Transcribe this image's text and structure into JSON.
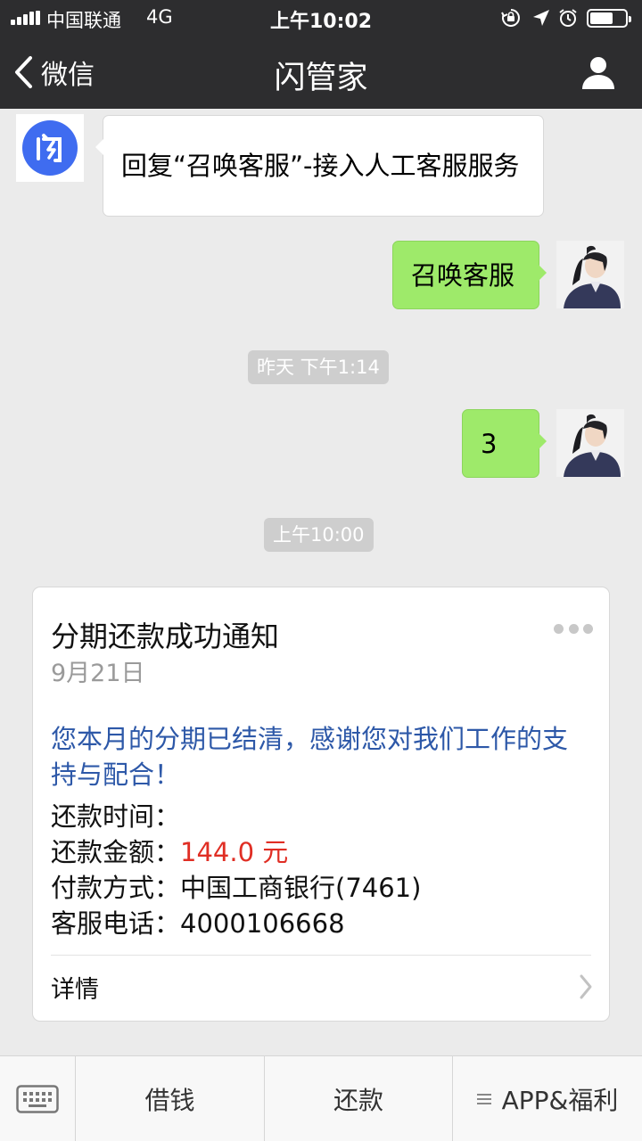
{
  "status_bar": {
    "carrier": "中国联通",
    "network": "4G",
    "time": "上午10:02",
    "battery_level": 0.65
  },
  "nav": {
    "back_label": "微信",
    "title": "闪管家"
  },
  "messages": [
    {
      "from": "bot",
      "text": "回复“召唤客服”-接入人工客服服务"
    },
    {
      "from": "user",
      "text": "召唤客服"
    },
    {
      "from": "system",
      "text": "昨天 下午1:14"
    },
    {
      "from": "user",
      "text": "3"
    },
    {
      "from": "system",
      "text": "上午10:00"
    }
  ],
  "card": {
    "title": "分期还款成功通知",
    "date": "9月21日",
    "intro": "您本月的分期已结清，感谢您对我们工作的支持与配合！",
    "rows": [
      {
        "label": "还款时间：",
        "value": ""
      },
      {
        "label": "还款金额：",
        "value": "144.0 元"
      },
      {
        "label": "付款方式：",
        "value": "中国工商银行(7461)"
      },
      {
        "label": "客服电话：",
        "value": "4000106668"
      }
    ],
    "detail_label": "详情"
  },
  "bottom_menu": {
    "items": [
      "借钱",
      "还款",
      "APP&福利"
    ]
  },
  "colors": {
    "nav_bg": "#2d2d2f",
    "chat_bg": "#ebebeb",
    "bubble_out": "#9eea6a",
    "intro_text": "#2d58a8",
    "amount": "#e02e24",
    "bot_logo": "#3f6cf0"
  }
}
